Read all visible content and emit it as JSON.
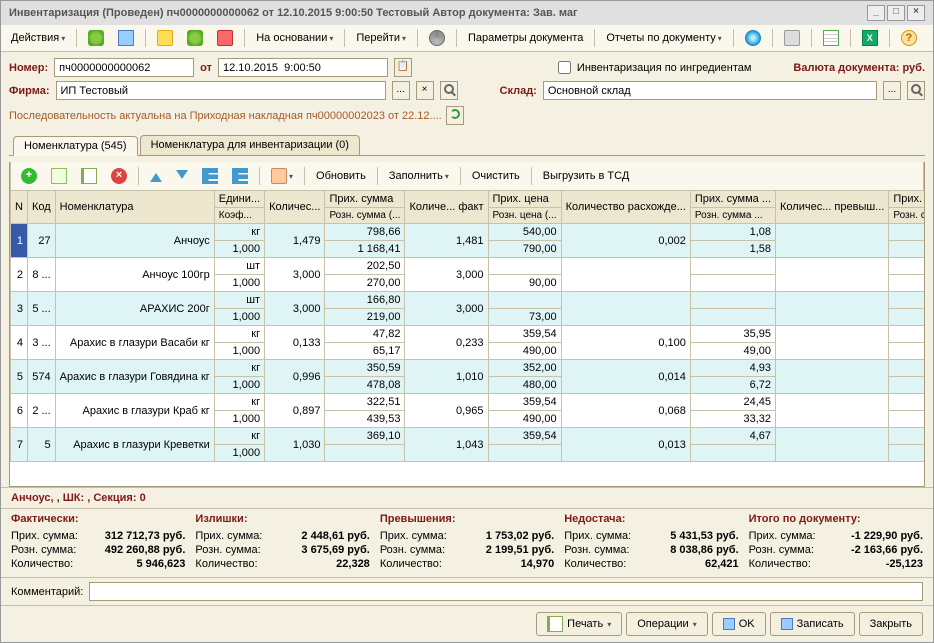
{
  "window": {
    "title": "Инвентаризация (Проведен)  пч0000000000062 от 12.10.2015 9:00:50 Тестовый Автор документа: Зав. маг"
  },
  "toolbar": {
    "actions": "Действия",
    "based_on": "На основании",
    "goto": "Перейти",
    "doc_params": "Параметры документа",
    "doc_reports": "Отчеты по документу"
  },
  "header": {
    "number_lbl": "Номер:",
    "number": "пч0000000000062",
    "from_lbl": "от",
    "date": "12.10.2015  9:00:50",
    "ingr_flag": "Инвентаризация по ингредиентам",
    "currency_lbl": "Валюта документа: руб.",
    "firm_lbl": "Фирма:",
    "firm": "ИП Тестовый",
    "store_lbl": "Склад:",
    "store": "Основной склад",
    "seq_note": "Последовательность актуальна на Приходная накладная пч00000002023 от 22.12...."
  },
  "tabs": {
    "tab1": "Номенклатура (545)",
    "tab2": "Номенклатура для инвентаризации (0)"
  },
  "grid_tb": {
    "refresh": "Обновить",
    "fill": "Заполнить",
    "clear": "Очистить",
    "export_tsd": "Выгрузить в ТСД"
  },
  "columns": {
    "n": "N",
    "code": "Код",
    "nom": "Номенклатура",
    "unit": "Едини...",
    "coef": "Коэф...",
    "qty": "Количес...",
    "sum_in": "Прих. сумма",
    "sum_retail": "Розн. сумма (...",
    "qty_fact": "Количе... факт",
    "price_in": "Прих. цена",
    "price_retail": "Розн. цена (...",
    "qty_diff": "Количество расхожде...",
    "sum_in_d": "Прих. сумма ...",
    "sum_retail_d": "Розн. сумма ...",
    "qty_over": "Количес... превыш...",
    "sum_in_over": "Прих. сумма превы...",
    "sum_retail_over": "Розн. сумма превы..."
  },
  "rows": [
    {
      "n": 1,
      "code": "27",
      "nom": "Анчоус",
      "unit": "кг",
      "coef": "1,000",
      "qty": "1,479",
      "sum_in": "798,66",
      "sum_retail": "1 168,41",
      "qty_fact": "1,481",
      "price_in": "540,00",
      "price_retail": "790,00",
      "qty_diff": "0,002",
      "sum_in_d": "1,08",
      "sum_retail_d": "1,58",
      "qty_over": "",
      "sum_in_over": "",
      "sum_retail_over": ""
    },
    {
      "n": 2,
      "code": "8 ...",
      "nom": "Анчоус 100гр",
      "unit": "шт",
      "coef": "1,000",
      "qty": "3,000",
      "sum_in": "202,50",
      "sum_retail": "270,00",
      "qty_fact": "3,000",
      "price_in": "",
      "price_retail": "90,00",
      "qty_diff": "",
      "sum_in_d": "",
      "sum_retail_d": "",
      "qty_over": "",
      "sum_in_over": "",
      "sum_retail_over": ""
    },
    {
      "n": 3,
      "code": "5 ...",
      "nom": "АРАХИС 200г",
      "unit": "шт",
      "coef": "1,000",
      "qty": "3,000",
      "sum_in": "166,80",
      "sum_retail": "219,00",
      "qty_fact": "3,000",
      "price_in": "",
      "price_retail": "73,00",
      "qty_diff": "",
      "sum_in_d": "",
      "sum_retail_d": "",
      "qty_over": "",
      "sum_in_over": "",
      "sum_retail_over": ""
    },
    {
      "n": 4,
      "code": "3 ...",
      "nom": "Арахис в глазури Васаби кг",
      "unit": "кг",
      "coef": "1,000",
      "qty": "0,133",
      "sum_in": "47,82",
      "sum_retail": "65,17",
      "qty_fact": "0,233",
      "price_in": "359,54",
      "price_retail": "490,00",
      "qty_diff": "0,100",
      "sum_in_d": "35,95",
      "sum_retail_d": "49,00",
      "qty_over": "",
      "sum_in_over": "",
      "sum_retail_over": ""
    },
    {
      "n": 5,
      "code": "574",
      "nom": "Арахис в глазури Говядина кг",
      "unit": "кг",
      "coef": "1,000",
      "qty": "0,996",
      "sum_in": "350,59",
      "sum_retail": "478,08",
      "qty_fact": "1,010",
      "price_in": "352,00",
      "price_retail": "480,00",
      "qty_diff": "0,014",
      "sum_in_d": "4,93",
      "sum_retail_d": "6,72",
      "qty_over": "",
      "sum_in_over": "",
      "sum_retail_over": ""
    },
    {
      "n": 6,
      "code": "2 ...",
      "nom": "Арахис в глазури Краб кг",
      "unit": "кг",
      "coef": "1,000",
      "qty": "0,897",
      "sum_in": "322,51",
      "sum_retail": "439,53",
      "qty_fact": "0,965",
      "price_in": "359,54",
      "price_retail": "490,00",
      "qty_diff": "0,068",
      "sum_in_d": "24,45",
      "sum_retail_d": "33,32",
      "qty_over": "",
      "sum_in_over": "",
      "sum_retail_over": ""
    },
    {
      "n": 7,
      "code": "5",
      "nom": "Арахис в глазури Креветки",
      "unit": "кг",
      "coef": "1,000",
      "qty": "1,030",
      "sum_in": "369,10",
      "sum_retail": "",
      "qty_fact": "1,043",
      "price_in": "359,54",
      "price_retail": "",
      "qty_diff": "0,013",
      "sum_in_d": "4,67",
      "sum_retail_d": "",
      "qty_over": "",
      "sum_in_over": "",
      "sum_retail_over": ""
    }
  ],
  "current_row_info": "Анчоус, , ШК: , Секция:  0",
  "totals": {
    "fact": {
      "title": "Фактически:",
      "l1": "Прих. сумма:",
      "v1": "312 712,73 руб.",
      "l2": "Розн. сумма:",
      "v2": "492 260,88 руб.",
      "l3": "Количество:",
      "v3": "5 946,623"
    },
    "over": {
      "title": "Излишки:",
      "l1": "Прих. сумма:",
      "v1": "2 448,61 руб.",
      "l2": "Розн. сумма:",
      "v2": "3 675,69 руб.",
      "l3": "Количество:",
      "v3": "22,328"
    },
    "excess": {
      "title": "Превышения:",
      "l1": "Прих. сумма:",
      "v1": "1 753,02 руб.",
      "l2": "Розн. сумма:",
      "v2": "2 199,51 руб.",
      "l3": "Количество:",
      "v3": "14,970"
    },
    "short": {
      "title": "Недостача:",
      "l1": "Прих. сумма:",
      "v1": "5 431,53 руб.",
      "l2": "Розн. сумма:",
      "v2": "8 038,86 руб.",
      "l3": "Количество:",
      "v3": "62,421"
    },
    "doc": {
      "title": "Итого по документу:",
      "l1": "Прих. сумма:",
      "v1": "-1 229,90 руб.",
      "l2": "Розн. сумма:",
      "v2": "-2 163,66 руб.",
      "l3": "Количество:",
      "v3": "-25,123"
    }
  },
  "comment_lbl": "Комментарий:",
  "buttons": {
    "print": "Печать",
    "ops": "Операции",
    "ok": "OK",
    "save": "Записать",
    "close": "Закрыть"
  }
}
